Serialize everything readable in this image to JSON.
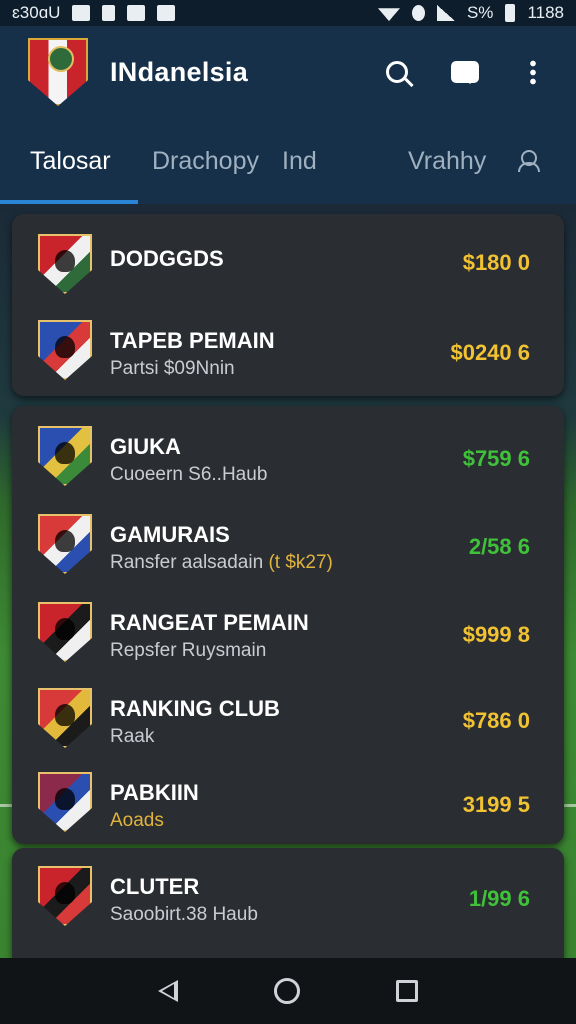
{
  "status_bar": {
    "time_left": "ɛ30ɑU",
    "battery": "S%",
    "time_right": "1188"
  },
  "app_bar": {
    "title": "INdanelsia",
    "logo_icon": "crest-icon",
    "search_icon": "search-icon",
    "chat_icon": "chat-icon",
    "more_icon": "more-vert-icon"
  },
  "tabs": [
    {
      "label": "Talosar",
      "active": true
    },
    {
      "label": "Drachopy",
      "active": false
    },
    {
      "label": "Ind",
      "active": false
    },
    {
      "label": "Vrahhy",
      "active": false
    }
  ],
  "groups": [
    {
      "rows": [
        {
          "name": "DODGGDS",
          "subtitle": "",
          "price": "$180 0",
          "price_color": "gold",
          "crest": [
            "#c9232c",
            "#f0f0f0",
            "#2f6b3a"
          ]
        },
        {
          "name": "TAPEB PEMAIN",
          "subtitle": "Partsi $09Nnin",
          "price": "$0240 6",
          "price_color": "gold",
          "crest": [
            "#2a4fb0",
            "#d83a3a",
            "#f0f0f0"
          ]
        }
      ]
    },
    {
      "rows": [
        {
          "name": "GIUKA",
          "subtitle": "Cuoeern S6..Haub",
          "price": "$759 6",
          "price_color": "green",
          "crest": [
            "#2a4fb0",
            "#e2c040",
            "#3a8a3a"
          ]
        },
        {
          "name": "GAMURAIS",
          "subtitle": "Ransfer aalsadain",
          "subtitle_accent": "(t $k27)",
          "price": "2/58 6",
          "price_color": "green",
          "crest": [
            "#d83a3a",
            "#f0f0f0",
            "#2a4fb0"
          ]
        },
        {
          "name": "RANGEAT PEMAIN",
          "subtitle": "Repsfer Ruysmain",
          "price": "$999 8",
          "price_color": "gold",
          "crest": [
            "#c9232c",
            "#1b1b1b",
            "#f0f0f0"
          ]
        },
        {
          "name": "RANKING CLUB",
          "subtitle": "Raak",
          "price": "$786 0",
          "price_color": "gold",
          "crest": [
            "#d83a3a",
            "#e2b93a",
            "#1b1b1b"
          ]
        },
        {
          "name": "PABKIIN",
          "subtitle": "Aoads",
          "subtitle_gold": true,
          "price": "3199 5",
          "price_color": "gold",
          "crest": [
            "#8b2a4a",
            "#2a4fb0",
            "#f0f0f0"
          ]
        }
      ]
    },
    {
      "rows": [
        {
          "name": "CLUTER",
          "subtitle": "Saoobirt.38 Haub",
          "price": "1/99 6",
          "price_color": "green",
          "crest": [
            "#c9232c",
            "#1b1b1b",
            "#d83a3a"
          ]
        }
      ]
    }
  ],
  "nav_bar": {
    "back_icon": "back-triangle-icon",
    "home_icon": "home-circle-icon",
    "recents_icon": "recents-square-icon"
  }
}
